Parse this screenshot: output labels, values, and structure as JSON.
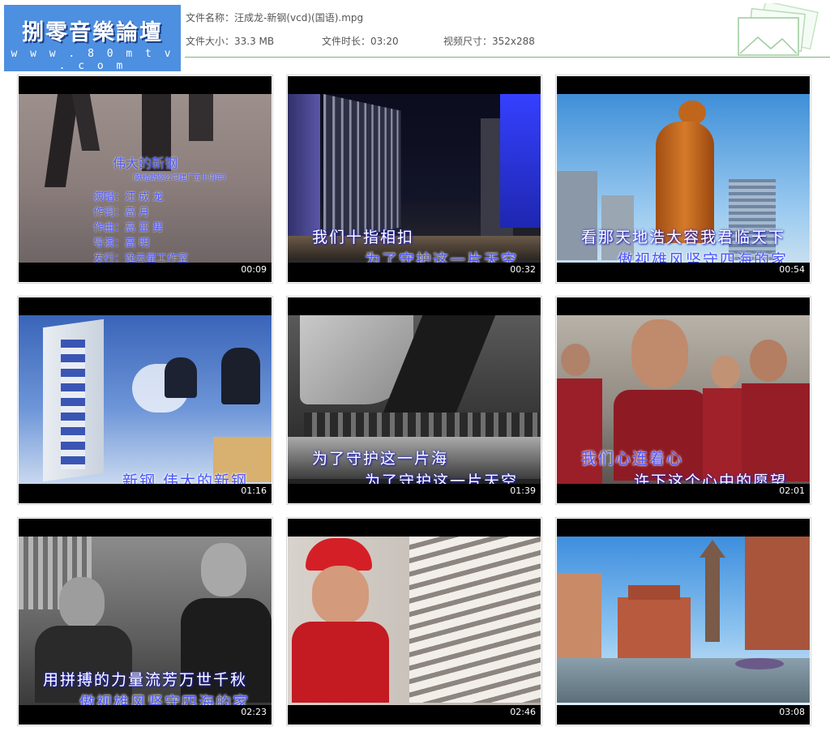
{
  "header": {
    "logo_title": "捌零音樂論壇",
    "logo_url": "w w w . 8 0 m t v . c o m",
    "file_name": "文件名称：汪成龙-新钢(vcd)(国语).mpg",
    "file_size": "文件大小：33.3 MB",
    "duration": "文件时长：03:20",
    "video_size": "视频尺寸：352x288",
    "accent_color": "#4d8fe0",
    "line_color": "#74b874"
  },
  "thumbnails": [
    {
      "time": "00:09",
      "credits": {
        "title": "伟大的新钢",
        "subtitle": "（献给新钢公司建厂五十周年）",
        "lines": [
          "演唱：汪 成 龙",
          "作词：高    月",
          "作曲：高 亚 男",
          "导演：高    明",
          "发行：逸云星工作室"
        ]
      }
    },
    {
      "time": "00:32",
      "sub1": "我们十指相扣",
      "sub2": "为了守护这一片天空"
    },
    {
      "time": "00:54",
      "sub1": "看那天地浩大容我君临天下",
      "sub2": "傲视雄风坚守四海的家"
    },
    {
      "time": "01:16",
      "sub1": "新钢 伟大的新钢"
    },
    {
      "time": "01:39",
      "sub1": "为了守护这一片海",
      "sub2": "为了守护这一片天空"
    },
    {
      "time": "02:01",
      "sub1": "我们心连着心",
      "sub2": "许下这个心中的愿望"
    },
    {
      "time": "02:23",
      "sub1": "用拼搏的力量流芳万世千秋",
      "sub2": "傲视雄风坚守四海的家"
    },
    {
      "time": "02:46"
    },
    {
      "time": "03:08"
    }
  ]
}
